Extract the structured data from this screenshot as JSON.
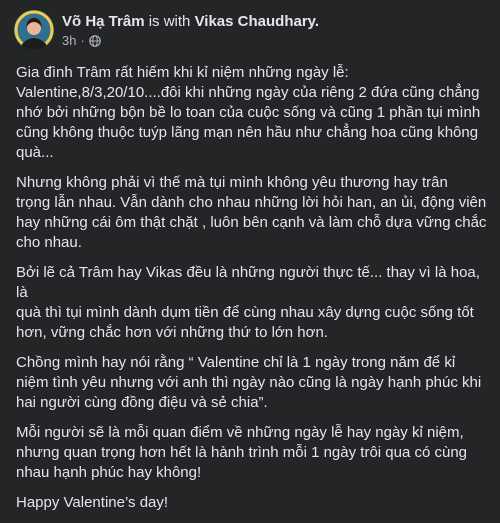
{
  "post": {
    "author": "Võ Hạ Trâm",
    "with_text": "is with",
    "tagged": "Vikas Chaudhary.",
    "time": "3h",
    "separator": "·",
    "privacy_icon": "globe-icon",
    "paragraphs": [
      "Gia đình Trâm rất hiếm khi kỉ niệm những ngày lễ:\nValentine,8/3,20/10....đôi khi những ngày của riêng 2 đứa cũng chẳng\nnhớ bởi những bộn bề lo toan của cuộc sống và cũng 1 phần tụi mình\ncũng không thuộc tuýp lãng mạn nên hầu như chẳng hoa cũng không\nquà...",
      "Nhưng không phải vì thế mà tụi mình không yêu thương hay trân\ntrọng lẫn nhau. Vẫn dành cho nhau những lời hỏi han, an ủi, động viên\nhay những cái ôm thật chặt , luôn bên cạnh và làm chỗ dựa vững chắc\ncho nhau.",
      "Bởi lẽ cả Trâm hay Vikas đều là những người thực tế... thay vì là hoa, là\nquà thì tụi mình dành dụm tiền để cùng nhau xây dựng cuộc sống tốt\nhơn, vững chắc hơn với những thứ to lớn hơn.",
      "Chồng mình hay nói rằng “ Valentine chỉ là 1 ngày trong năm để kỉ\nniệm tình yêu nhưng với anh thì ngày nào cũng là ngày hạnh phúc khi\nhai người cùng đồng điệu và sẻ chia”.",
      "Mỗi người sẽ là mỗi quan điểm về những ngày lễ hay ngày kỉ niệm,\nnhưng quan trọng hơn hết là hành trình mỗi 1 ngày trôi qua có cùng\nnhau hạnh phúc hay không!",
      "Happy Valentine’s day!"
    ]
  }
}
